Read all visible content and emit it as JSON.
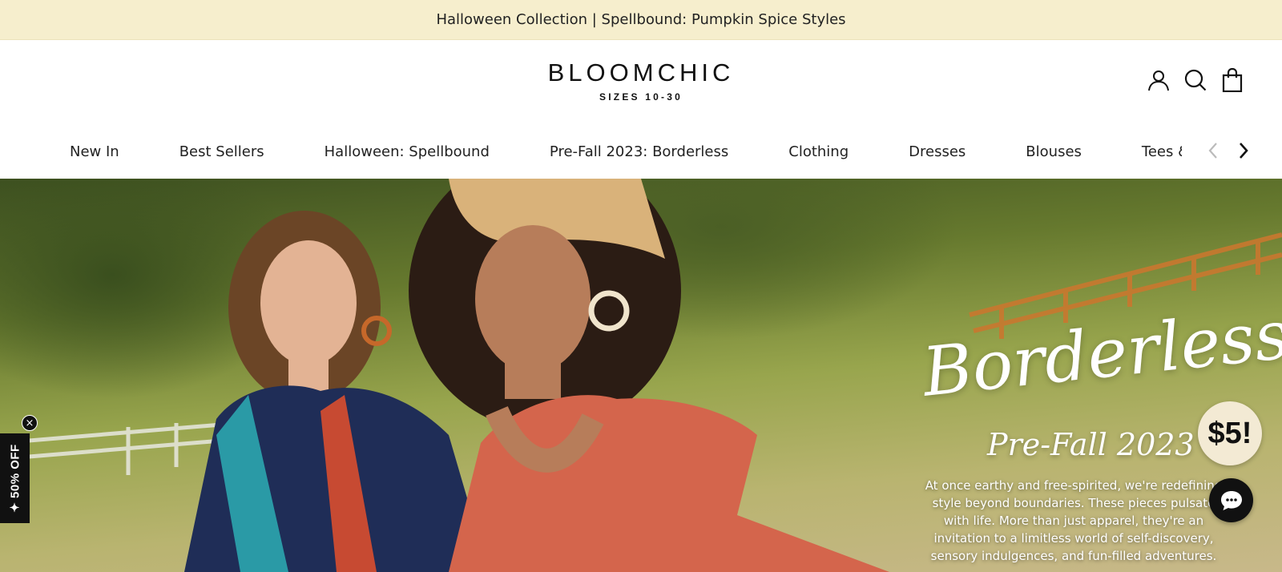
{
  "announcement": {
    "text": "Halloween Collection | Spellbound: Pumpkin Spice Styles"
  },
  "logo": {
    "name": "BLOOMCHIC",
    "tagline": "SIZES 10-30"
  },
  "header_icons": [
    {
      "name": "account-icon"
    },
    {
      "name": "search-icon"
    },
    {
      "name": "shopping-bag-icon"
    }
  ],
  "nav": {
    "items": [
      {
        "label": "New In"
      },
      {
        "label": "Best Sellers"
      },
      {
        "label": "Halloween: Spellbound"
      },
      {
        "label": "Pre-Fall 2023: Borderless"
      },
      {
        "label": "Clothing"
      },
      {
        "label": "Dresses"
      },
      {
        "label": "Blouses"
      },
      {
        "label": "Tees & S"
      }
    ],
    "prev_icon": "chevron-left-icon",
    "next_icon": "chevron-right-icon"
  },
  "hero": {
    "title": "Borderless",
    "subtitle": "Pre-Fall 2023",
    "description": "At once earthy and free-spirited, we're redefining style beyond boundaries. These pieces pulsate with life. More than just apparel, they're an invitation to a limitless world of self-discovery, sensory indulgences, and fun-filled adventures."
  },
  "promo_tab": {
    "text": "✦ 50% OFF",
    "close": "×"
  },
  "price_badge": {
    "text": "$5!"
  },
  "chat": {
    "icon": "chat-bubble-icon"
  },
  "colors": {
    "announcement_bg": "#f6eecd",
    "text": "#1a1a1a",
    "promo_bg": "#111111",
    "badge_bg": "#f3ead4"
  }
}
